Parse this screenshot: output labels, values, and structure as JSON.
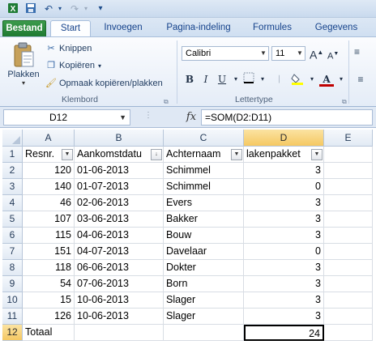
{
  "quick_access": {
    "save_icon": "save-icon",
    "undo_icon": "undo-icon",
    "redo_icon": "redo-icon",
    "customize_icon": "customize-qat-icon"
  },
  "tabs": [
    {
      "label": "Bestand"
    },
    {
      "label": "Start"
    },
    {
      "label": "Invoegen"
    },
    {
      "label": "Pagina-indeling"
    },
    {
      "label": "Formules"
    },
    {
      "label": "Gegevens"
    }
  ],
  "clipboard": {
    "paste_label": "Plakken",
    "cut_label": "Knippen",
    "copy_label": "Kopiëren",
    "format_painter_label": "Opmaak kopiëren/plakken",
    "group_label": "Klembord"
  },
  "font": {
    "name": "Calibri",
    "size": "11",
    "bold_label": "B",
    "italic_label": "I",
    "underline_label": "U",
    "grow_label": "A",
    "shrink_label": "A",
    "group_label": "Lettertype",
    "font_color": "#c00000",
    "fill_color": "#ffff00"
  },
  "formula_bar": {
    "name_box": "D12",
    "fx_label": "fx",
    "formula": "=SOM(D2:D11)"
  },
  "columns": [
    "A",
    "B",
    "C",
    "D",
    "E"
  ],
  "selected_column": "D",
  "selected_row": "12",
  "rows": [
    {
      "n": "1",
      "a": "Resnr.",
      "b": "Aankomstdatu",
      "c": "Achternaam",
      "d": "lakenpakket"
    },
    {
      "n": "2",
      "a": "120",
      "b": "01-06-2013",
      "c": "Schimmel",
      "d": "3"
    },
    {
      "n": "3",
      "a": "140",
      "b": "01-07-2013",
      "c": "Schimmel",
      "d": "0"
    },
    {
      "n": "4",
      "a": "46",
      "b": "02-06-2013",
      "c": "Evers",
      "d": "3"
    },
    {
      "n": "5",
      "a": "107",
      "b": "03-06-2013",
      "c": "Bakker",
      "d": "3"
    },
    {
      "n": "6",
      "a": "115",
      "b": "04-06-2013",
      "c": "Bouw",
      "d": "3"
    },
    {
      "n": "7",
      "a": "151",
      "b": "04-07-2013",
      "c": "Davelaar",
      "d": "0"
    },
    {
      "n": "8",
      "a": "118",
      "b": "06-06-2013",
      "c": "Dokter",
      "d": "3"
    },
    {
      "n": "9",
      "a": "54",
      "b": "07-06-2013",
      "c": "Born",
      "d": "3"
    },
    {
      "n": "10",
      "a": "15",
      "b": "10-06-2013",
      "c": "Slager",
      "d": "3"
    },
    {
      "n": "11",
      "a": "126",
      "b": "10-06-2013",
      "c": "Slager",
      "d": "3"
    },
    {
      "n": "12",
      "a": "Totaal",
      "b": "",
      "c": "",
      "d": "24"
    }
  ]
}
